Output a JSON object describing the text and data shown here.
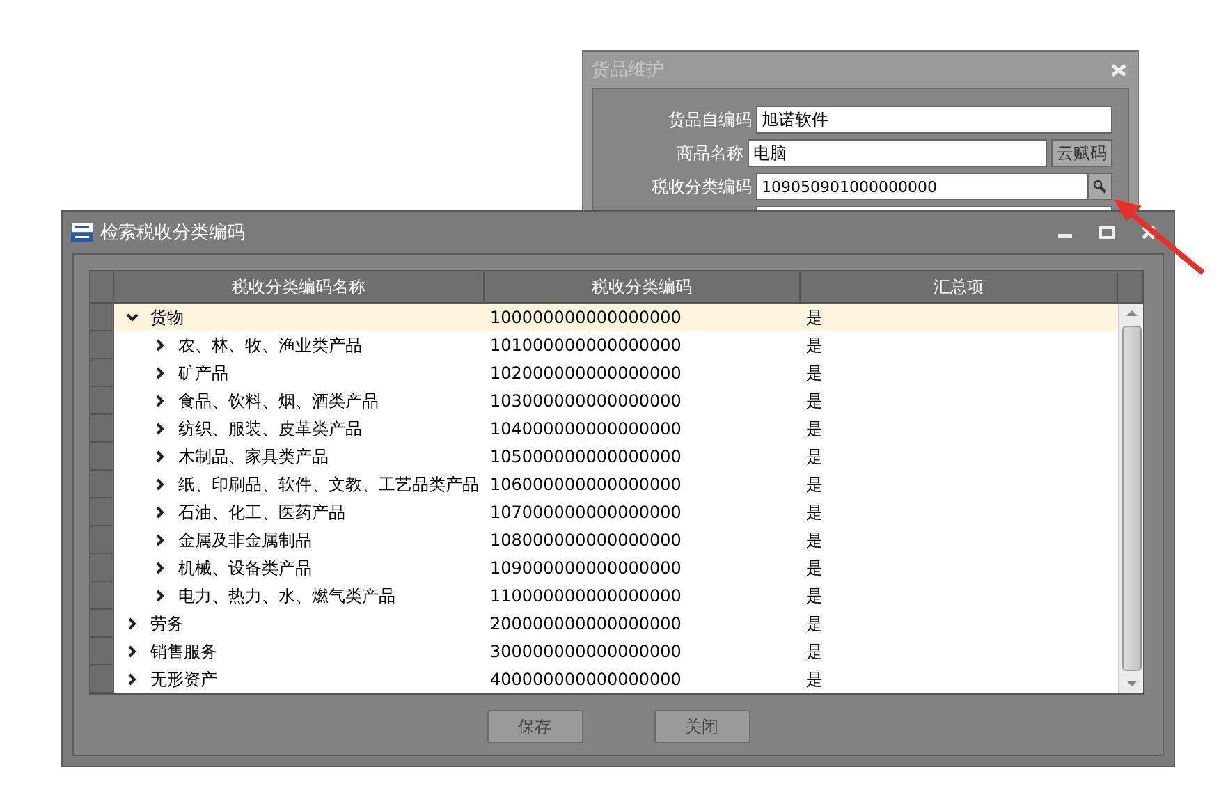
{
  "back_window": {
    "title": "货品维护",
    "fields": [
      {
        "kind": "text",
        "label": "货品自编码",
        "value": "旭诺软件"
      },
      {
        "kind": "button",
        "label": "商品名称",
        "value": "电脑",
        "button": "云赋码"
      },
      {
        "kind": "search",
        "label": "税收分类编码",
        "value": "109050901000000000"
      },
      {
        "kind": "text"
      }
    ]
  },
  "search_window": {
    "title": "检索税收分类编码",
    "columns": [
      "税收分类编码名称",
      "税收分类编码",
      "汇总项"
    ],
    "rows": [
      {
        "name": "货物",
        "code": "100000000000000000",
        "summary": "是",
        "expanded": true,
        "selected": true,
        "children": [
          {
            "name": "农、林、牧、渔业类产品",
            "code": "101000000000000000",
            "summary": "是",
            "expanded": false,
            "selected": false
          },
          {
            "name": "矿产品",
            "code": "102000000000000000",
            "summary": "是",
            "expanded": false,
            "selected": false
          },
          {
            "name": "食品、饮料、烟、酒类产品",
            "code": "103000000000000000",
            "summary": "是",
            "expanded": false,
            "selected": false
          },
          {
            "name": "纺织、服装、皮革类产品",
            "code": "104000000000000000",
            "summary": "是",
            "expanded": false,
            "selected": false
          },
          {
            "name": "木制品、家具类产品",
            "code": "105000000000000000",
            "summary": "是",
            "expanded": false,
            "selected": false
          },
          {
            "name": "纸、印刷品、软件、文教、工艺品类产品",
            "code": "106000000000000000",
            "summary": "是",
            "expanded": false,
            "selected": false
          },
          {
            "name": "石油、化工、医药产品",
            "code": "107000000000000000",
            "summary": "是",
            "expanded": false,
            "selected": false
          },
          {
            "name": "金属及非金属制品",
            "code": "108000000000000000",
            "summary": "是",
            "expanded": false,
            "selected": false
          },
          {
            "name": "机械、设备类产品",
            "code": "109000000000000000",
            "summary": "是",
            "expanded": false,
            "selected": false
          },
          {
            "name": "电力、热力、水、燃气类产品",
            "code": "110000000000000000",
            "summary": "是",
            "expanded": false,
            "selected": false
          }
        ]
      },
      {
        "name": "劳务",
        "code": "200000000000000000",
        "summary": "是",
        "expanded": false,
        "selected": false
      },
      {
        "name": "销售服务",
        "code": "300000000000000000",
        "summary": "是",
        "expanded": false,
        "selected": false
      },
      {
        "name": "无形资产",
        "code": "400000000000000000",
        "summary": "是",
        "expanded": false,
        "selected": false
      }
    ],
    "buttons": [
      "保存",
      "关闭"
    ]
  }
}
